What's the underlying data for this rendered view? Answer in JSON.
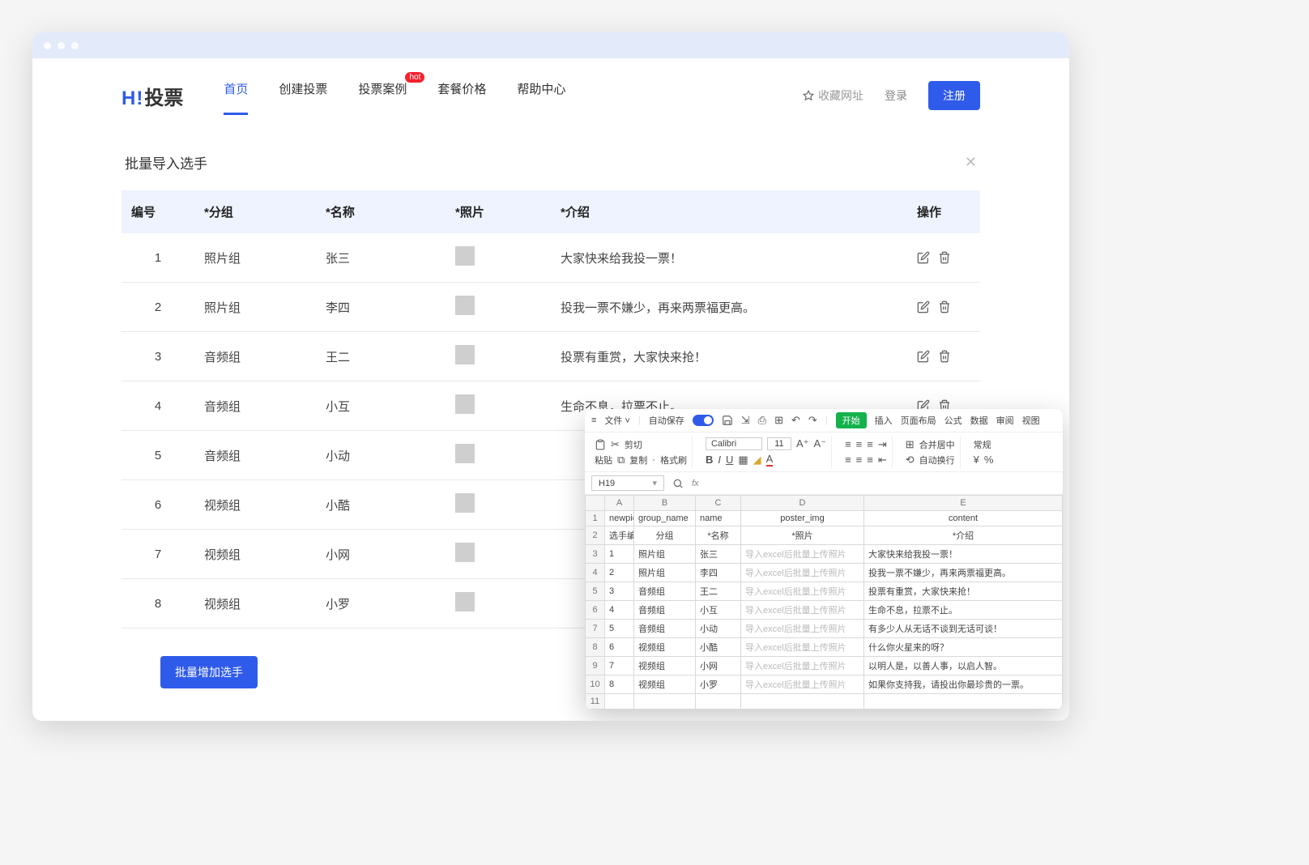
{
  "nav": {
    "logo_hi": "H",
    "logo_ex": "!",
    "logo_txt": "投票",
    "items": [
      "首页",
      "创建投票",
      "投票案例",
      "套餐价格",
      "帮助中心"
    ],
    "hot": "hot",
    "collect": "收藏网址",
    "login": "登录",
    "register": "注册"
  },
  "section": {
    "title": "批量导入选手"
  },
  "table": {
    "headers": [
      "编号",
      "*分组",
      "*名称",
      "*照片",
      "*介绍",
      "操作"
    ],
    "rows": [
      {
        "id": "1",
        "group": "照片组",
        "name": "张三",
        "intro": "大家快来给我投一票！"
      },
      {
        "id": "2",
        "group": "照片组",
        "name": "李四",
        "intro": "投我一票不嫌少，再来两票福更高。"
      },
      {
        "id": "3",
        "group": "音频组",
        "name": "王二",
        "intro": "投票有重赏，大家快来抢！"
      },
      {
        "id": "4",
        "group": "音频组",
        "name": "小互",
        "intro": "生命不息，拉票不止。"
      },
      {
        "id": "5",
        "group": "音频组",
        "name": "小动",
        "intro": ""
      },
      {
        "id": "6",
        "group": "视频组",
        "name": "小酷",
        "intro": ""
      },
      {
        "id": "7",
        "group": "视频组",
        "name": "小网",
        "intro": ""
      },
      {
        "id": "8",
        "group": "视频组",
        "name": "小罗",
        "intro": ""
      }
    ]
  },
  "batch_btn": "批量增加选手",
  "sheet": {
    "menu": {
      "file": "文件",
      "autosave": "自动保存",
      "tabs": [
        "开始",
        "插入",
        "页面布局",
        "公式",
        "数据",
        "审阅",
        "视图"
      ]
    },
    "ribbon": {
      "paste": "粘贴",
      "cut": "剪切",
      "copy": "复制",
      "fmt": "格式刷",
      "font": "Calibri",
      "size": "11",
      "merge": "合并居中",
      "wrap": "自动换行",
      "general": "常规"
    },
    "cellref": "H19",
    "cols": [
      "A",
      "B",
      "C",
      "D",
      "E"
    ],
    "header1": [
      "newpid",
      "group_name",
      "name",
      "poster_img",
      "content"
    ],
    "header2": [
      "选手编号",
      "分组",
      "*名称",
      "*照片",
      "*介绍"
    ],
    "phototxt": "导入excel后批量上传照片",
    "rows": [
      {
        "n": "3",
        "a": "1",
        "b": "照片组",
        "c": "张三",
        "e": "大家快来给我投一票！"
      },
      {
        "n": "4",
        "a": "2",
        "b": "照片组",
        "c": "李四",
        "e": "投我一票不嫌少，再来两票福更高。"
      },
      {
        "n": "5",
        "a": "3",
        "b": "音频组",
        "c": "王二",
        "e": "投票有重赏，大家快来抢！"
      },
      {
        "n": "6",
        "a": "4",
        "b": "音频组",
        "c": "小互",
        "e": "生命不息，拉票不止。"
      },
      {
        "n": "7",
        "a": "5",
        "b": "音频组",
        "c": "小动",
        "e": "有多少人从无话不谈到无话可谈！"
      },
      {
        "n": "8",
        "a": "6",
        "b": "视频组",
        "c": "小酷",
        "e": "什么你火星来的呀？"
      },
      {
        "n": "9",
        "a": "7",
        "b": "视频组",
        "c": "小网",
        "e": "以明人是，以善人事，以启人智。"
      },
      {
        "n": "10",
        "a": "8",
        "b": "视频组",
        "c": "小罗",
        "e": "如果你支持我，请投出你最珍贵的一票。"
      }
    ]
  }
}
